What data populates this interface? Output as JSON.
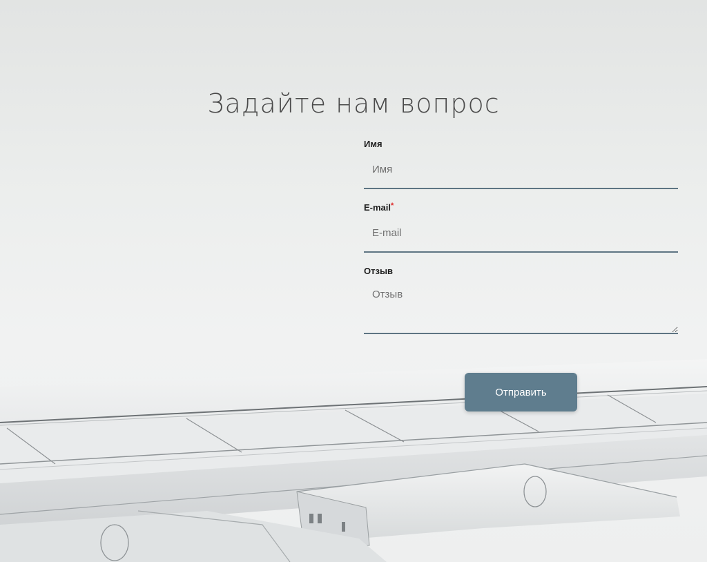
{
  "page": {
    "title": "Задайте нам вопрос"
  },
  "form": {
    "name": {
      "label": "Имя",
      "placeholder": "Имя",
      "value": ""
    },
    "email": {
      "label": "E-mail",
      "required_mark": "*",
      "placeholder": "E-mail",
      "value": ""
    },
    "review": {
      "label": "Отзыв",
      "placeholder": "Отзыв",
      "value": ""
    },
    "submit_label": "Отправить"
  },
  "colors": {
    "accent": "#5f7d8e",
    "field_border": "#5e7583",
    "title_text": "#4a4a4a"
  },
  "background": {
    "image": "airplane-wing"
  }
}
